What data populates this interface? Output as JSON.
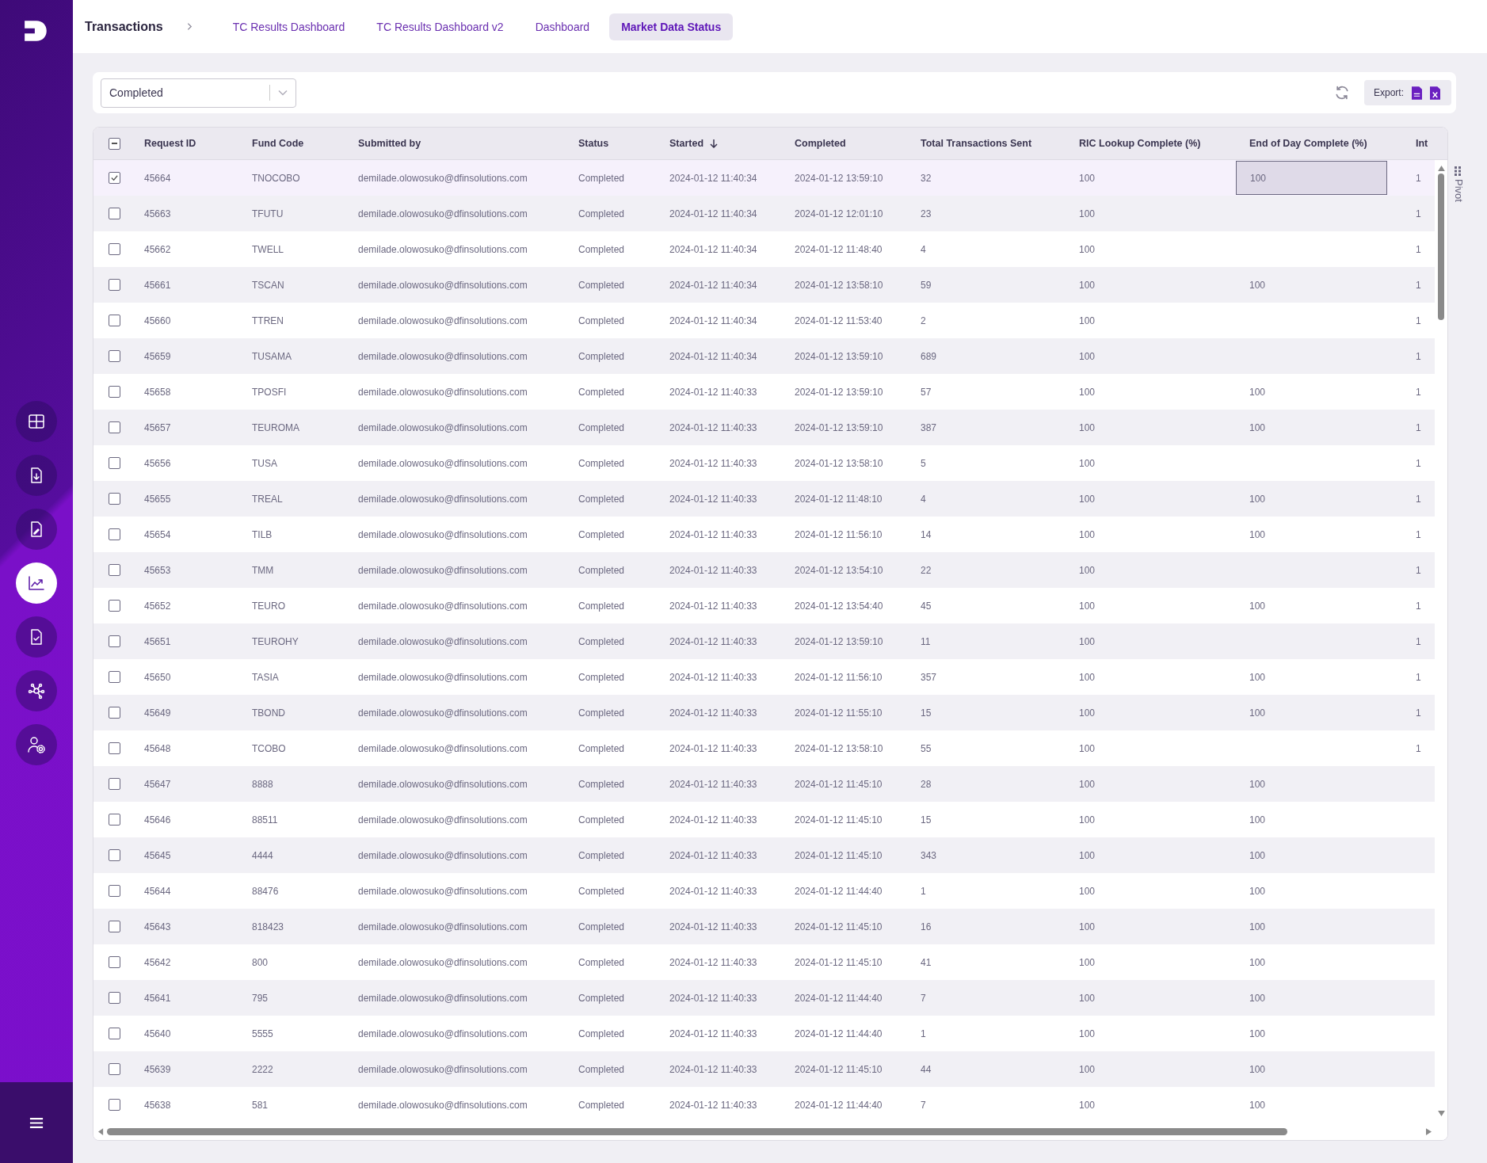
{
  "sidebar": {
    "items": [
      {
        "kind": "grid",
        "selected": false
      },
      {
        "kind": "file-download",
        "selected": false
      },
      {
        "kind": "file-edit",
        "selected": false
      },
      {
        "kind": "chart",
        "selected": true
      },
      {
        "kind": "file-check",
        "selected": false
      },
      {
        "kind": "network",
        "selected": false
      },
      {
        "kind": "user-settings",
        "selected": false
      }
    ]
  },
  "breadcrumb": "Transactions",
  "tabs": [
    {
      "label": "TC Results Dashboard",
      "selected": false
    },
    {
      "label": "TC Results Dashboard v2",
      "selected": false
    },
    {
      "label": "Dashboard",
      "selected": false
    },
    {
      "label": "Market Data Status",
      "selected": true
    }
  ],
  "toolbar": {
    "status_filter": "Completed",
    "export_label": "Export:"
  },
  "table": {
    "header_checkbox": {
      "indeterminate": true
    },
    "columns": [
      {
        "label": "Request ID"
      },
      {
        "label": "Fund Code"
      },
      {
        "label": "Submitted by"
      },
      {
        "label": "Status"
      },
      {
        "label": "Started",
        "sorted_descending": true
      },
      {
        "label": "Completed"
      },
      {
        "label": "Total Transactions Sent"
      },
      {
        "label": "RIC Lookup Complete (%)"
      },
      {
        "label": "End of Day Complete (%)"
      },
      {
        "label": "Int"
      }
    ],
    "rows": [
      {
        "selected": true,
        "focused": true,
        "cells": [
          "45664",
          "TNOCOBO",
          "demilade.olowosuko@dfinsolutions.com",
          "Completed",
          "2024-01-12 11:40:34",
          "2024-01-12 13:59:10",
          "32",
          "100",
          "100",
          "1"
        ]
      },
      {
        "selected": false,
        "focused": false,
        "cells": [
          "45663",
          "TFUTU",
          "demilade.olowosuko@dfinsolutions.com",
          "Completed",
          "2024-01-12 11:40:34",
          "2024-01-12 12:01:10",
          "23",
          "100",
          null,
          "1"
        ]
      },
      {
        "selected": false,
        "focused": false,
        "cells": [
          "45662",
          "TWELL",
          "demilade.olowosuko@dfinsolutions.com",
          "Completed",
          "2024-01-12 11:40:34",
          "2024-01-12 11:48:40",
          "4",
          "100",
          null,
          "1"
        ]
      },
      {
        "selected": false,
        "focused": false,
        "cells": [
          "45661",
          "TSCAN",
          "demilade.olowosuko@dfinsolutions.com",
          "Completed",
          "2024-01-12 11:40:34",
          "2024-01-12 13:58:10",
          "59",
          "100",
          "100",
          "1"
        ]
      },
      {
        "selected": false,
        "focused": false,
        "cells": [
          "45660",
          "TTREN",
          "demilade.olowosuko@dfinsolutions.com",
          "Completed",
          "2024-01-12 11:40:34",
          "2024-01-12 11:53:40",
          "2",
          "100",
          null,
          "1"
        ]
      },
      {
        "selected": false,
        "focused": false,
        "cells": [
          "45659",
          "TUSAMA",
          "demilade.olowosuko@dfinsolutions.com",
          "Completed",
          "2024-01-12 11:40:34",
          "2024-01-12 13:59:10",
          "689",
          "100",
          null,
          "1"
        ]
      },
      {
        "selected": false,
        "focused": false,
        "cells": [
          "45658",
          "TPOSFI",
          "demilade.olowosuko@dfinsolutions.com",
          "Completed",
          "2024-01-12 11:40:33",
          "2024-01-12 13:59:10",
          "57",
          "100",
          "100",
          "1"
        ]
      },
      {
        "selected": false,
        "focused": false,
        "cells": [
          "45657",
          "TEUROMA",
          "demilade.olowosuko@dfinsolutions.com",
          "Completed",
          "2024-01-12 11:40:33",
          "2024-01-12 13:59:10",
          "387",
          "100",
          "100",
          "1"
        ]
      },
      {
        "selected": false,
        "focused": false,
        "cells": [
          "45656",
          "TUSA",
          "demilade.olowosuko@dfinsolutions.com",
          "Completed",
          "2024-01-12 11:40:33",
          "2024-01-12 13:58:10",
          "5",
          "100",
          null,
          "1"
        ]
      },
      {
        "selected": false,
        "focused": false,
        "cells": [
          "45655",
          "TREAL",
          "demilade.olowosuko@dfinsolutions.com",
          "Completed",
          "2024-01-12 11:40:33",
          "2024-01-12 11:48:10",
          "4",
          "100",
          "100",
          "1"
        ]
      },
      {
        "selected": false,
        "focused": false,
        "cells": [
          "45654",
          "TILB",
          "demilade.olowosuko@dfinsolutions.com",
          "Completed",
          "2024-01-12 11:40:33",
          "2024-01-12 11:56:10",
          "14",
          "100",
          "100",
          "1"
        ]
      },
      {
        "selected": false,
        "focused": false,
        "cells": [
          "45653",
          "TMM",
          "demilade.olowosuko@dfinsolutions.com",
          "Completed",
          "2024-01-12 11:40:33",
          "2024-01-12 13:54:10",
          "22",
          "100",
          null,
          "1"
        ]
      },
      {
        "selected": false,
        "focused": false,
        "cells": [
          "45652",
          "TEURO",
          "demilade.olowosuko@dfinsolutions.com",
          "Completed",
          "2024-01-12 11:40:33",
          "2024-01-12 13:54:40",
          "45",
          "100",
          "100",
          "1"
        ]
      },
      {
        "selected": false,
        "focused": false,
        "cells": [
          "45651",
          "TEUROHY",
          "demilade.olowosuko@dfinsolutions.com",
          "Completed",
          "2024-01-12 11:40:33",
          "2024-01-12 13:59:10",
          "11",
          "100",
          null,
          "1"
        ]
      },
      {
        "selected": false,
        "focused": false,
        "cells": [
          "45650",
          "TASIA",
          "demilade.olowosuko@dfinsolutions.com",
          "Completed",
          "2024-01-12 11:40:33",
          "2024-01-12 11:56:10",
          "357",
          "100",
          "100",
          "1"
        ]
      },
      {
        "selected": false,
        "focused": false,
        "cells": [
          "45649",
          "TBOND",
          "demilade.olowosuko@dfinsolutions.com",
          "Completed",
          "2024-01-12 11:40:33",
          "2024-01-12 11:55:10",
          "15",
          "100",
          "100",
          "1"
        ]
      },
      {
        "selected": false,
        "focused": false,
        "cells": [
          "45648",
          "TCOBO",
          "demilade.olowosuko@dfinsolutions.com",
          "Completed",
          "2024-01-12 11:40:33",
          "2024-01-12 13:58:10",
          "55",
          "100",
          null,
          "1"
        ]
      },
      {
        "selected": false,
        "focused": false,
        "cells": [
          "45647",
          "8888",
          "demilade.olowosuko@dfinsolutions.com",
          "Completed",
          "2024-01-12 11:40:33",
          "2024-01-12 11:45:10",
          "28",
          "100",
          "100"
        ]
      },
      {
        "selected": false,
        "focused": false,
        "cells": [
          "45646",
          "88511",
          "demilade.olowosuko@dfinsolutions.com",
          "Completed",
          "2024-01-12 11:40:33",
          "2024-01-12 11:45:10",
          "15",
          "100",
          "100"
        ]
      },
      {
        "selected": false,
        "focused": false,
        "cells": [
          "45645",
          "4444",
          "demilade.olowosuko@dfinsolutions.com",
          "Completed",
          "2024-01-12 11:40:33",
          "2024-01-12 11:45:10",
          "343",
          "100",
          "100"
        ]
      },
      {
        "selected": false,
        "focused": false,
        "cells": [
          "45644",
          "88476",
          "demilade.olowosuko@dfinsolutions.com",
          "Completed",
          "2024-01-12 11:40:33",
          "2024-01-12 11:44:40",
          "1",
          "100",
          "100"
        ]
      },
      {
        "selected": false,
        "focused": false,
        "cells": [
          "45643",
          "818423",
          "demilade.olowosuko@dfinsolutions.com",
          "Completed",
          "2024-01-12 11:40:33",
          "2024-01-12 11:45:10",
          "16",
          "100",
          "100"
        ]
      },
      {
        "selected": false,
        "focused": false,
        "cells": [
          "45642",
          "800",
          "demilade.olowosuko@dfinsolutions.com",
          "Completed",
          "2024-01-12 11:40:33",
          "2024-01-12 11:45:10",
          "41",
          "100",
          "100"
        ]
      },
      {
        "selected": false,
        "focused": false,
        "cells": [
          "45641",
          "795",
          "demilade.olowosuko@dfinsolutions.com",
          "Completed",
          "2024-01-12 11:40:33",
          "2024-01-12 11:44:40",
          "7",
          "100",
          "100"
        ]
      },
      {
        "selected": false,
        "focused": false,
        "cells": [
          "45640",
          "5555",
          "demilade.olowosuko@dfinsolutions.com",
          "Completed",
          "2024-01-12 11:40:33",
          "2024-01-12 11:44:40",
          "1",
          "100",
          "100"
        ]
      },
      {
        "selected": false,
        "focused": false,
        "cells": [
          "45639",
          "2222",
          "demilade.olowosuko@dfinsolutions.com",
          "Completed",
          "2024-01-12 11:40:33",
          "2024-01-12 11:45:10",
          "44",
          "100",
          "100"
        ]
      },
      {
        "selected": false,
        "focused": false,
        "cells": [
          "45638",
          "581",
          "demilade.olowosuko@dfinsolutions.com",
          "Completed",
          "2024-01-12 11:40:33",
          "2024-01-12 11:44:40",
          "7",
          "100",
          "100"
        ]
      }
    ]
  },
  "pivot_label": "Pivot"
}
